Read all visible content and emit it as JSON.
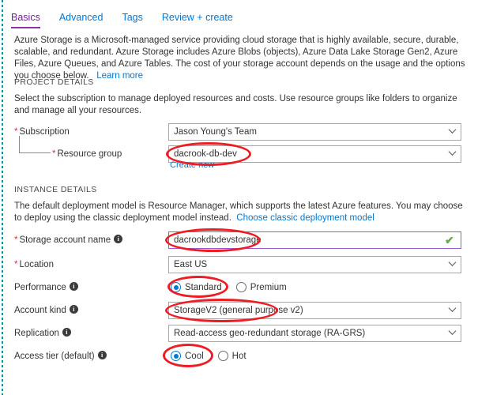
{
  "tabs": [
    {
      "label": "Basics",
      "active": true
    },
    {
      "label": "Advanced",
      "active": false
    },
    {
      "label": "Tags",
      "active": false
    },
    {
      "label": "Review + create",
      "active": false
    }
  ],
  "intro": {
    "text": "Azure Storage is a Microsoft-managed service providing cloud storage that is highly available, secure, durable, scalable, and redundant. Azure Storage includes Azure Blobs (objects), Azure Data Lake Storage Gen2, Azure Files, Azure Queues, and Azure Tables. The cost of your storage account depends on the usage and the options you choose below.",
    "learn_more": "Learn more"
  },
  "project_details": {
    "heading": "PROJECT DETAILS",
    "description": "Select the subscription to manage deployed resources and costs. Use resource groups like folders to organize and manage all your resources.",
    "subscription": {
      "label": "Subscription",
      "required": true,
      "value": "Jason Young's Team"
    },
    "resource_group": {
      "label": "Resource group",
      "required": true,
      "value": "dacrook-db-dev",
      "create_new_link": "Create new"
    }
  },
  "instance_details": {
    "heading": "INSTANCE DETAILS",
    "description": "The default deployment model is Resource Manager, which supports the latest Azure features. You may choose to deploy using the classic deployment model instead.",
    "classic_link": "Choose classic deployment model",
    "storage_account_name": {
      "label": "Storage account name",
      "required": true,
      "has_info": true,
      "value": "dacrookdbdevstorage",
      "valid": true,
      "validation_icon": "checkmark-icon"
    },
    "location": {
      "label": "Location",
      "required": true,
      "value": "East US"
    },
    "performance": {
      "label": "Performance",
      "has_info": true,
      "options": [
        {
          "label": "Standard",
          "selected": true
        },
        {
          "label": "Premium",
          "selected": false
        }
      ]
    },
    "account_kind": {
      "label": "Account kind",
      "has_info": true,
      "value": "StorageV2 (general purpose v2)"
    },
    "replication": {
      "label": "Replication",
      "has_info": true,
      "value": "Read-access geo-redundant storage (RA-GRS)"
    },
    "access_tier": {
      "label": "Access tier (default)",
      "has_info": true,
      "options": [
        {
          "label": "Cool",
          "selected": true
        },
        {
          "label": "Hot",
          "selected": false
        }
      ]
    }
  },
  "annotations": {
    "color": "#ee1c25",
    "highlighted": [
      "resource-group-value",
      "storage-account-name-value",
      "performance-standard-option",
      "account-kind-value",
      "access-tier-cool-option"
    ]
  },
  "icons": {
    "info": "i",
    "chevron_down": "chevron-down-icon",
    "checkmark": "✔"
  }
}
